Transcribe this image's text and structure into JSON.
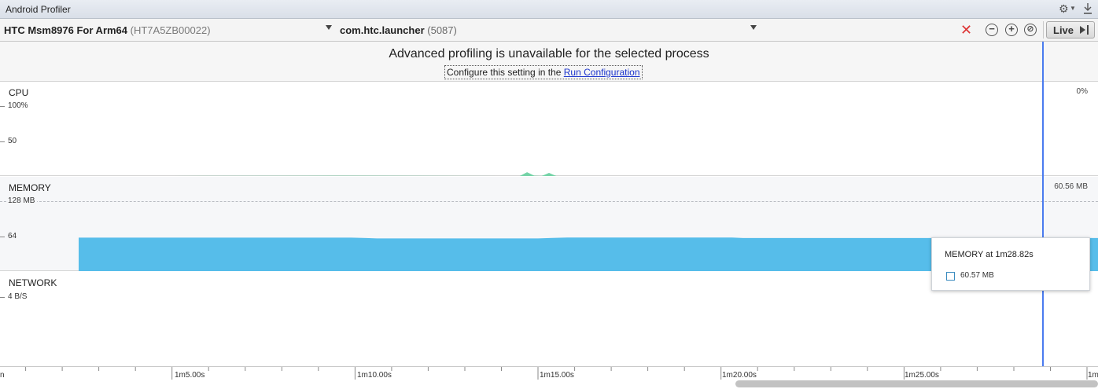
{
  "window": {
    "title": "Android Profiler"
  },
  "toolbar": {
    "device_name": "HTC Msm8976 For Arm64",
    "device_serial": "(HT7A5ZB00022)",
    "process_name": "com.htc.launcher",
    "process_pid": "(5087)",
    "zoom_out": "−",
    "zoom_in": "+",
    "zoom_reset": "⊘",
    "live_label": "Live"
  },
  "banner": {
    "headline": "Advanced profiling is unavailable for the selected process",
    "sub_text": "Configure this setting in the ",
    "sub_link": "Run Configuration"
  },
  "cpu": {
    "title": "CPU",
    "current_value": "0%",
    "tick_top": "100%",
    "tick_mid": "50"
  },
  "memory": {
    "title": "MEMORY",
    "current_value": "60.56 MB",
    "tick_top": "128 MB",
    "tick_mid": "64"
  },
  "network": {
    "title": "NETWORK",
    "tick_top": "4 B/S"
  },
  "timeline": {
    "left_edge_label": "n",
    "right_edge_label": "1m",
    "labels": [
      "1m5.00s",
      "1m10.00s",
      "1m15.00s",
      "1m20.00s",
      "1m25.00s"
    ]
  },
  "tooltip": {
    "title": "MEMORY at 1m28.82s",
    "value": "60.57 MB"
  },
  "colors": {
    "memory_fill": "#56bdea",
    "cpu_fill": "#74d3a7",
    "cursor": "#4a7bef",
    "close_red": "#d33333"
  },
  "chart_data": {
    "type": "area",
    "title": "",
    "xlabel": "",
    "ylabel": "MEMORY",
    "x_unit": "seconds",
    "xlim": [
      60.3,
      90.3
    ],
    "ylim": [
      0,
      128
    ],
    "series": [
      {
        "name": "MEMORY",
        "x": [
          62.45,
          69.9,
          70.3,
          70.6,
          75.0,
          75.4,
          75.8,
          80.3,
          80.6,
          88.82,
          90.3
        ],
        "y": [
          61.3,
          61.3,
          60.5,
          59.8,
          59.8,
          60.8,
          61.6,
          61.6,
          60.6,
          60.57,
          60.6
        ]
      },
      {
        "name": "CPU",
        "x": [
          65.0,
          69.6,
          74.5,
          74.7,
          74.9,
          75.1,
          75.3,
          75.5,
          90.3
        ],
        "y": [
          0,
          0.5,
          0,
          5.5,
          0.5,
          0,
          4.5,
          0,
          0
        ]
      }
    ]
  }
}
